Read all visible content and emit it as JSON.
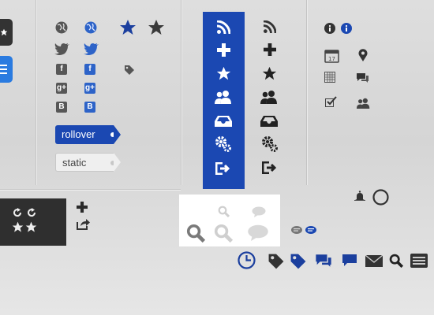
{
  "buttons": {
    "rollover_label": "rollover",
    "static_label": "static"
  },
  "social": {
    "facebook_glyph": "f",
    "googleplus_glyph": "g+",
    "blogger_glyph": "B"
  },
  "colors": {
    "accent_blue": "#1b48b2",
    "icon_dark": "#333333",
    "icon_gray": "#575757",
    "light_gray": "#c9c9c9"
  },
  "icons": [
    "star-icon",
    "menu-icon",
    "globe-icon",
    "twitter-icon",
    "facebook-icon",
    "googleplus-icon",
    "blogger-icon",
    "tag-icon",
    "rss-icon",
    "plus-icon",
    "users-icon",
    "inbox-icon",
    "gears-icon",
    "logout-icon",
    "info-icon",
    "calendar-icon",
    "map-pin-icon",
    "grid-calendar-icon",
    "chat-icon",
    "checkbox-icon",
    "refresh-icon",
    "share-icon",
    "search-icon",
    "comment-icon",
    "bell-icon",
    "circle-icon",
    "clock-icon",
    "mail-icon",
    "archive-icon"
  ]
}
